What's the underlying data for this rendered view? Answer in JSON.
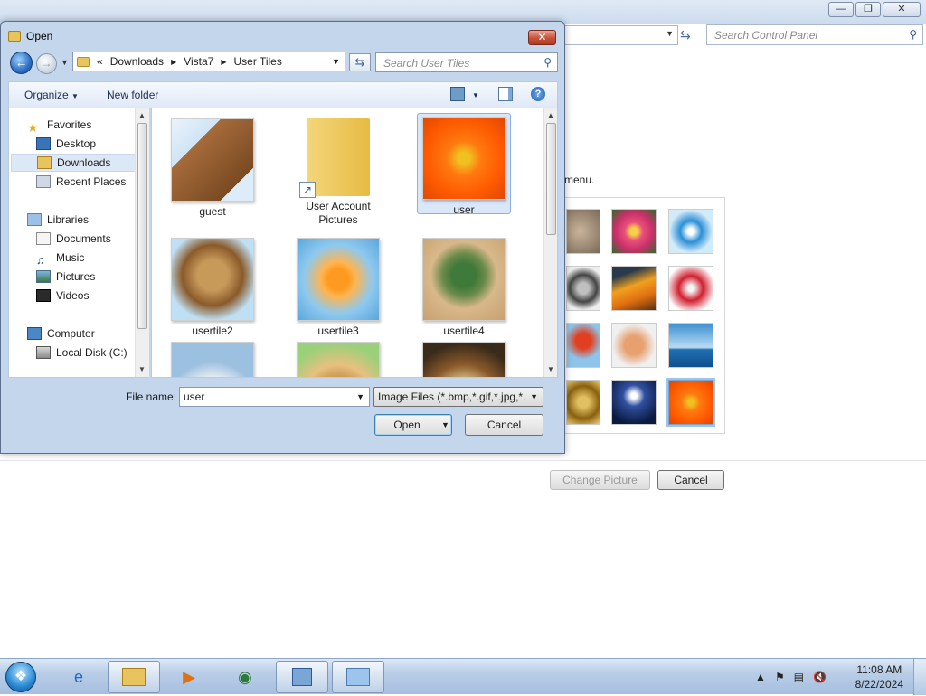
{
  "background": {
    "search_placeholder": "Search Control Panel",
    "menu_text": "menu.",
    "change_picture_label": "Change Picture",
    "cancel_label": "Cancel"
  },
  "dialog": {
    "title": "Open",
    "breadcrumb": [
      "«",
      "Downloads",
      "Vista7",
      "User Tiles"
    ],
    "search_placeholder": "Search User Tiles",
    "toolbar": {
      "organize": "Organize",
      "new_folder": "New folder"
    },
    "nav": {
      "favorites": "Favorites",
      "desktop": "Desktop",
      "downloads": "Downloads",
      "recent": "Recent Places",
      "libraries": "Libraries",
      "documents": "Documents",
      "music": "Music",
      "pictures": "Pictures",
      "videos": "Videos",
      "computer": "Computer",
      "local_disk": "Local Disk (C:)"
    },
    "files": [
      {
        "name": "guest"
      },
      {
        "name": "User Account Pictures"
      },
      {
        "name": "user"
      },
      {
        "name": "usertile2"
      },
      {
        "name": "usertile3"
      },
      {
        "name": "usertile4"
      }
    ],
    "filename_label": "File name:",
    "filename_value": "user",
    "filetype_value": "Image Files (*.bmp,*.gif,*.jpg,*.",
    "open_label": "Open",
    "cancel_label": "Cancel"
  },
  "taskbar": {
    "time": "11:08 AM",
    "date": "8/22/2024"
  }
}
